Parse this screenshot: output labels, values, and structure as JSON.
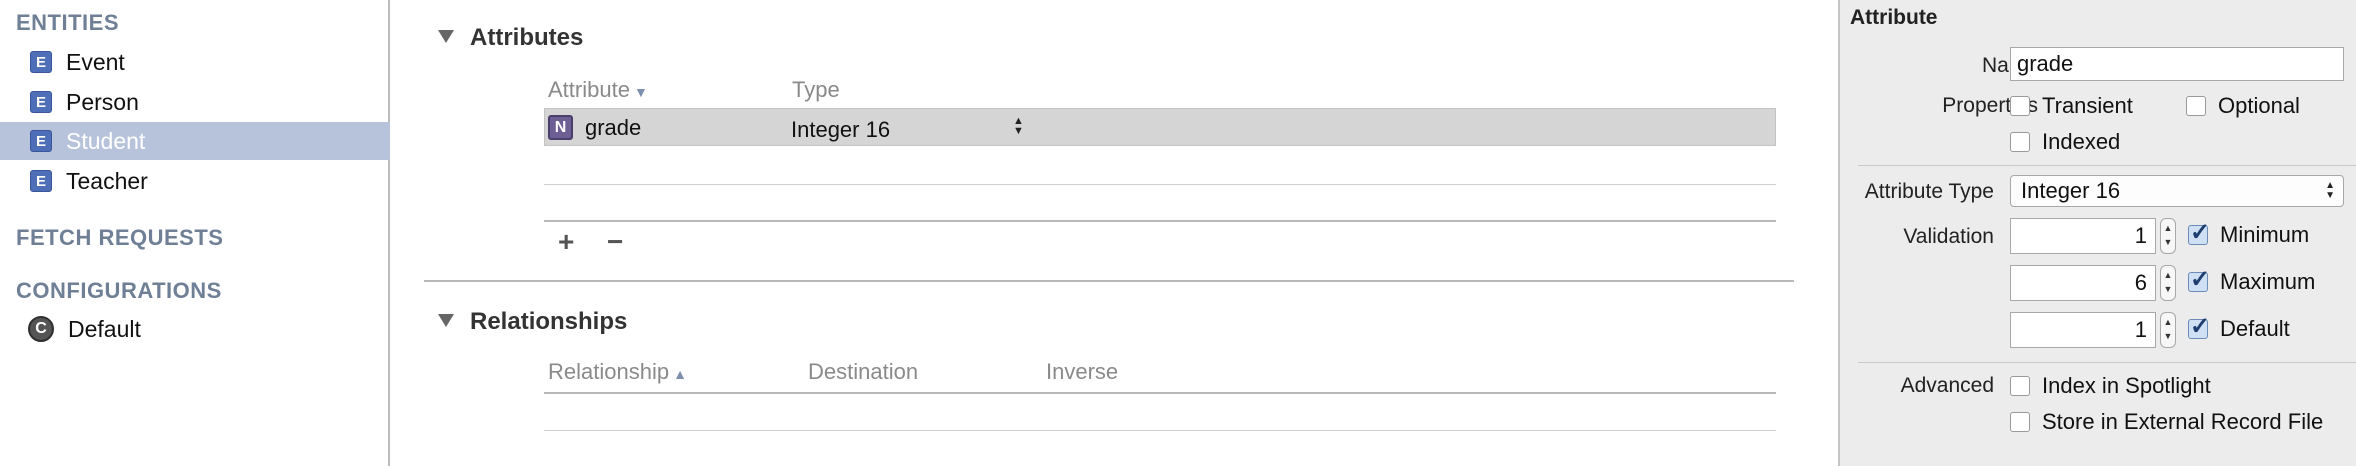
{
  "sidebar": {
    "entities_header": "ENTITIES",
    "entities": [
      {
        "badge": "E",
        "label": "Event"
      },
      {
        "badge": "E",
        "label": "Person"
      },
      {
        "badge": "E",
        "label": "Student",
        "selected": true
      },
      {
        "badge": "E",
        "label": "Teacher"
      }
    ],
    "fetch_header": "FETCH REQUESTS",
    "config_header": "CONFIGURATIONS",
    "configurations": [
      {
        "badge": "C",
        "label": "Default"
      }
    ]
  },
  "attributes": {
    "title": "Attributes",
    "columns": {
      "attribute": "Attribute",
      "type": "Type"
    },
    "sort_glyph": "▼",
    "rows": [
      {
        "badge": "N",
        "name": "grade",
        "type": "Integer 16"
      }
    ],
    "add_label": "+",
    "remove_label": "−"
  },
  "relationships": {
    "title": "Relationships",
    "columns": {
      "relationship": "Relationship",
      "destination": "Destination",
      "inverse": "Inverse"
    },
    "sort_glyph": "▲"
  },
  "inspector": {
    "title": "Attribute",
    "name_label": "Name",
    "name_value": "grade",
    "properties_label": "Properties",
    "transient_label": "Transient",
    "transient_checked": false,
    "optional_label": "Optional",
    "optional_checked": false,
    "indexed_label": "Indexed",
    "indexed_checked": false,
    "attribute_type_label": "Attribute Type",
    "attribute_type_value": "Integer 16",
    "validation_label": "Validation",
    "minimum_value": "1",
    "minimum_label": "Minimum",
    "minimum_checked": true,
    "maximum_value": "6",
    "maximum_label": "Maximum",
    "maximum_checked": true,
    "default_value": "1",
    "default_label": "Default",
    "default_checked": true,
    "advanced_label": "Advanced",
    "spotlight_label": "Index in Spotlight",
    "spotlight_checked": false,
    "external_label": "Store in External Record File",
    "external_checked": false
  },
  "icons": {
    "disclosure": "disclosure-triangle-icon",
    "entity": "entity-badge-icon",
    "configuration": "configuration-badge-icon",
    "numeric_attribute": "numeric-attribute-icon"
  },
  "colors": {
    "selection": "#b7c3da",
    "section_header": "#6e7f96",
    "entity_badge": "#4e6fb8",
    "attribute_badge": "#6d5f94",
    "checkbox_checked": "#1d3e6e"
  }
}
